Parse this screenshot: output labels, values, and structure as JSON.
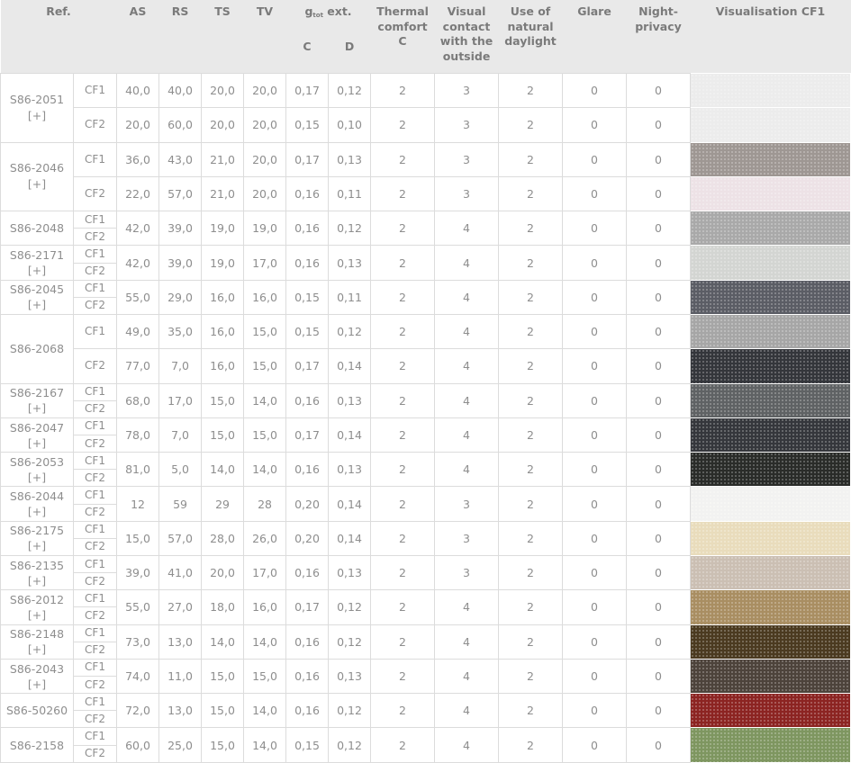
{
  "headers": {
    "ref": "Ref.",
    "as": "AS",
    "rs": "RS",
    "ts": "TS",
    "tv": "TV",
    "g_main": "g",
    "g_sub": "tot",
    "g_suffix": " ext.",
    "g_c": "C",
    "g_d": "D",
    "thermal": "Thermal comfort C",
    "visual": "Visual contact with the outside",
    "daylight": "Use of natural daylight",
    "glare": "Glare",
    "night": "Night-privacy",
    "vis": "Visualisation CF1"
  },
  "rows": [
    {
      "ref": "S86-2051 [+]",
      "layout": "split",
      "swatch": "#ececec",
      "variants": [
        {
          "cf": "CF1",
          "as": "40,0",
          "rs": "40,0",
          "ts": "20,0",
          "tv": "20,0",
          "c": "0,17",
          "d": "0,12",
          "thermal": "2",
          "visual": "3",
          "daylight": "2",
          "glare": "0",
          "night": "0"
        },
        {
          "cf": "CF2",
          "as": "20,0",
          "rs": "60,0",
          "ts": "20,0",
          "tv": "20,0",
          "c": "0,15",
          "d": "0,10",
          "thermal": "2",
          "visual": "3",
          "daylight": "2",
          "glare": "0",
          "night": "0"
        }
      ]
    },
    {
      "ref": "S86-2046 [+]",
      "layout": "split",
      "swatch": "#9e9793",
      "swatch2": "#ede2e6",
      "variants": [
        {
          "cf": "CF1",
          "as": "36,0",
          "rs": "43,0",
          "ts": "21,0",
          "tv": "20,0",
          "c": "0,17",
          "d": "0,13",
          "thermal": "2",
          "visual": "3",
          "daylight": "2",
          "glare": "0",
          "night": "0"
        },
        {
          "cf": "CF2",
          "as": "22,0",
          "rs": "57,0",
          "ts": "21,0",
          "tv": "20,0",
          "c": "0,16",
          "d": "0,11",
          "thermal": "2",
          "visual": "3",
          "daylight": "2",
          "glare": "0",
          "night": "0"
        }
      ]
    },
    {
      "ref": "S86-2048",
      "layout": "stack",
      "swatch": "#a9a9a9",
      "values": {
        "as": "42,0",
        "rs": "39,0",
        "ts": "19,0",
        "tv": "19,0",
        "c": "0,16",
        "d": "0,12",
        "thermal": "2",
        "visual": "4",
        "daylight": "2",
        "glare": "0",
        "night": "0"
      }
    },
    {
      "ref": "S86-2171 [+]",
      "layout": "stack",
      "swatch": "#d3d5d2",
      "values": {
        "as": "42,0",
        "rs": "39,0",
        "ts": "19,0",
        "tv": "17,0",
        "c": "0,16",
        "d": "0,13",
        "thermal": "2",
        "visual": "4",
        "daylight": "2",
        "glare": "0",
        "night": "0"
      }
    },
    {
      "ref": "S86-2045 [+]",
      "layout": "stack",
      "swatch": "#5b5d65",
      "values": {
        "as": "55,0",
        "rs": "29,0",
        "ts": "16,0",
        "tv": "16,0",
        "c": "0,15",
        "d": "0,11",
        "thermal": "2",
        "visual": "4",
        "daylight": "2",
        "glare": "0",
        "night": "0"
      }
    },
    {
      "ref": "S86-2068",
      "layout": "split",
      "swatch": "#a6a6a6",
      "swatch2": "#34363b",
      "variants": [
        {
          "cf": "CF1",
          "as": "49,0",
          "rs": "35,0",
          "ts": "16,0",
          "tv": "15,0",
          "c": "0,15",
          "d": "0,12",
          "thermal": "2",
          "visual": "4",
          "daylight": "2",
          "glare": "0",
          "night": "0"
        },
        {
          "cf": "CF2",
          "as": "77,0",
          "rs": "7,0",
          "ts": "16,0",
          "tv": "15,0",
          "c": "0,17",
          "d": "0,14",
          "thermal": "2",
          "visual": "4",
          "daylight": "2",
          "glare": "0",
          "night": "0"
        }
      ]
    },
    {
      "ref": "S86-2167 [+]",
      "layout": "stack",
      "swatch": "#5f6264",
      "values": {
        "as": "68,0",
        "rs": "17,0",
        "ts": "15,0",
        "tv": "14,0",
        "c": "0,16",
        "d": "0,13",
        "thermal": "2",
        "visual": "4",
        "daylight": "2",
        "glare": "0",
        "night": "0"
      }
    },
    {
      "ref": "S86-2047 [+]",
      "layout": "stack",
      "swatch": "#35373c",
      "values": {
        "as": "78,0",
        "rs": "7,0",
        "ts": "15,0",
        "tv": "15,0",
        "c": "0,17",
        "d": "0,14",
        "thermal": "2",
        "visual": "4",
        "daylight": "2",
        "glare": "0",
        "night": "0"
      }
    },
    {
      "ref": "S86-2053 [+]",
      "layout": "stack",
      "swatch": "#2a2c29",
      "values": {
        "as": "81,0",
        "rs": "5,0",
        "ts": "14,0",
        "tv": "14,0",
        "c": "0,16",
        "d": "0,13",
        "thermal": "2",
        "visual": "4",
        "daylight": "2",
        "glare": "0",
        "night": "0"
      }
    },
    {
      "ref": "S86-2044 [+]",
      "layout": "stack",
      "swatch": "#f2f2f1",
      "values": {
        "as": "12",
        "rs": "59",
        "ts": "29",
        "tv": "28",
        "c": "0,20",
        "d": "0,14",
        "thermal": "2",
        "visual": "3",
        "daylight": "2",
        "glare": "0",
        "night": "0"
      }
    },
    {
      "ref": "S86-2175 [+]",
      "layout": "stack",
      "swatch": "#e9dcbc",
      "values": {
        "as": "15,0",
        "rs": "57,0",
        "ts": "28,0",
        "tv": "26,0",
        "c": "0,20",
        "d": "0,14",
        "thermal": "2",
        "visual": "3",
        "daylight": "2",
        "glare": "0",
        "night": "0"
      }
    },
    {
      "ref": "S86-2135 [+]",
      "layout": "stack",
      "swatch": "#cbbfb3",
      "values": {
        "as": "39,0",
        "rs": "41,0",
        "ts": "20,0",
        "tv": "17,0",
        "c": "0,16",
        "d": "0,13",
        "thermal": "2",
        "visual": "3",
        "daylight": "2",
        "glare": "0",
        "night": "0"
      }
    },
    {
      "ref": "S86-2012 [+]",
      "layout": "stack",
      "swatch": "#a98e62",
      "values": {
        "as": "55,0",
        "rs": "27,0",
        "ts": "18,0",
        "tv": "16,0",
        "c": "0,17",
        "d": "0,12",
        "thermal": "2",
        "visual": "4",
        "daylight": "2",
        "glare": "0",
        "night": "0"
      }
    },
    {
      "ref": "S86-2148 [+]",
      "layout": "stack",
      "swatch": "#4b3a20",
      "values": {
        "as": "73,0",
        "rs": "13,0",
        "ts": "14,0",
        "tv": "14,0",
        "c": "0,16",
        "d": "0,12",
        "thermal": "2",
        "visual": "4",
        "daylight": "2",
        "glare": "0",
        "night": "0"
      }
    },
    {
      "ref": "S86-2043 [+]",
      "layout": "stack",
      "swatch": "#4d433b",
      "values": {
        "as": "74,0",
        "rs": "11,0",
        "ts": "15,0",
        "tv": "15,0",
        "c": "0,16",
        "d": "0,13",
        "thermal": "2",
        "visual": "4",
        "daylight": "2",
        "glare": "0",
        "night": "0"
      }
    },
    {
      "ref": "S86-50260",
      "layout": "stack",
      "swatch": "#8c2422",
      "values": {
        "as": "72,0",
        "rs": "13,0",
        "ts": "15,0",
        "tv": "14,0",
        "c": "0,16",
        "d": "0,12",
        "thermal": "2",
        "visual": "4",
        "daylight": "2",
        "glare": "0",
        "night": "0"
      }
    },
    {
      "ref": "S86-2158",
      "layout": "stack",
      "swatch": "#7e9660",
      "values": {
        "as": "60,0",
        "rs": "25,0",
        "ts": "15,0",
        "tv": "14,0",
        "c": "0,15",
        "d": "0,12",
        "thermal": "2",
        "visual": "4",
        "daylight": "2",
        "glare": "0",
        "night": "0"
      }
    }
  ]
}
